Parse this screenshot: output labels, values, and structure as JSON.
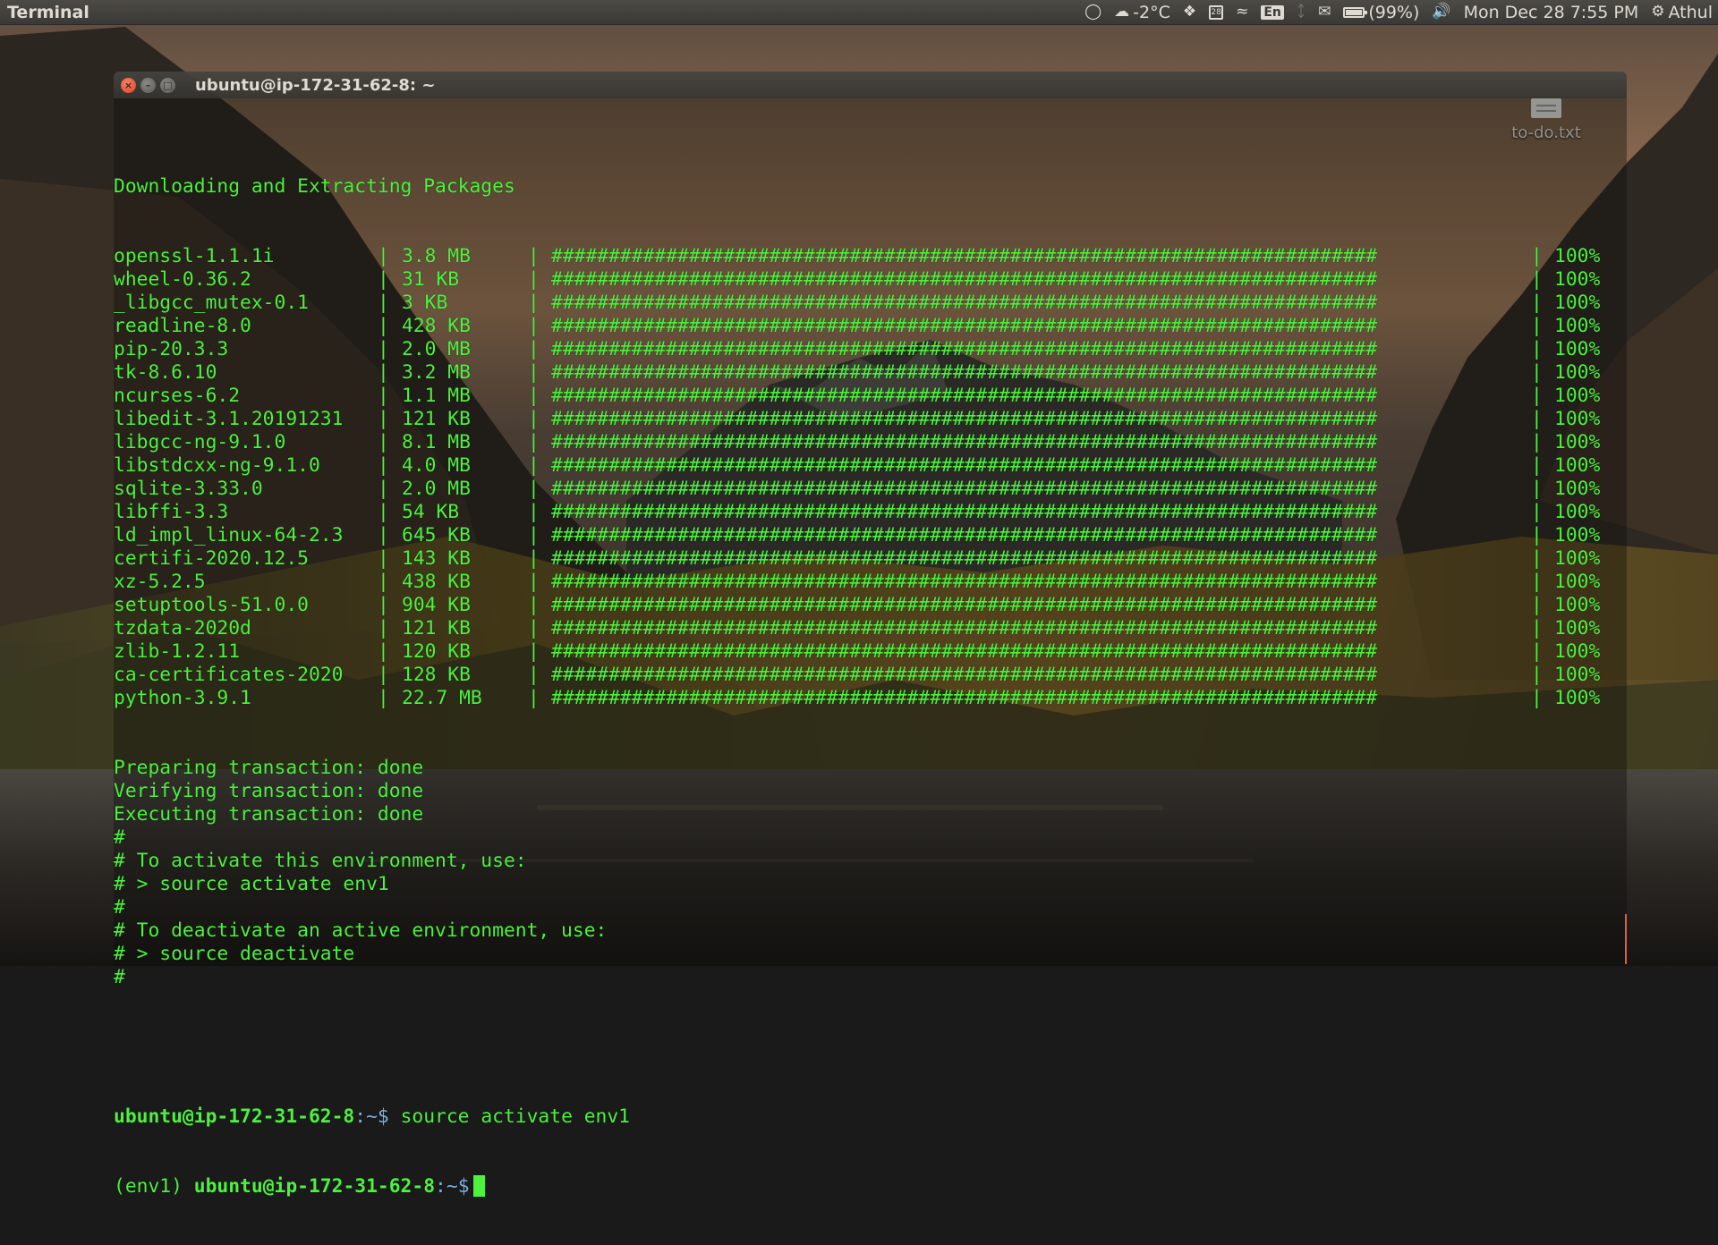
{
  "panel": {
    "app_title": "Terminal",
    "weather": "-2°C",
    "keyboard_layout": "En",
    "calendar_day": "28",
    "battery": "(99%)",
    "battery_level": 0.99,
    "datetime": "Mon Dec 28  7:55 PM",
    "user": "Athul",
    "icons": [
      "bulb-icon",
      "weather-icon",
      "dropbox-icon",
      "calendar-icon",
      "wifi-icon",
      "keyboard-icon",
      "bluetooth-icon",
      "mail-icon",
      "battery-icon",
      "volume-icon",
      "settings-gear-icon"
    ]
  },
  "window": {
    "title": "ubuntu@ip-172-31-62-8: ~"
  },
  "desktop": {
    "file_label": "to-do.txt"
  },
  "terminal": {
    "header": "Downloading and Extracting Packages",
    "progress_bar": "########################################################################",
    "packages": [
      {
        "name": "openssl-1.1.1i",
        "size": "3.8 MB",
        "percent": "100%"
      },
      {
        "name": "wheel-0.36.2",
        "size": "31 KB",
        "percent": "100%"
      },
      {
        "name": "_libgcc_mutex-0.1",
        "size": "3 KB",
        "percent": "100%"
      },
      {
        "name": "readline-8.0",
        "size": "428 KB",
        "percent": "100%"
      },
      {
        "name": "pip-20.3.3",
        "size": "2.0 MB",
        "percent": "100%"
      },
      {
        "name": "tk-8.6.10",
        "size": "3.2 MB",
        "percent": "100%"
      },
      {
        "name": "ncurses-6.2",
        "size": "1.1 MB",
        "percent": "100%"
      },
      {
        "name": "libedit-3.1.20191231",
        "size": "121 KB",
        "percent": "100%"
      },
      {
        "name": "libgcc-ng-9.1.0",
        "size": "8.1 MB",
        "percent": "100%"
      },
      {
        "name": "libstdcxx-ng-9.1.0",
        "size": "4.0 MB",
        "percent": "100%"
      },
      {
        "name": "sqlite-3.33.0",
        "size": "2.0 MB",
        "percent": "100%"
      },
      {
        "name": "libffi-3.3",
        "size": "54 KB",
        "percent": "100%"
      },
      {
        "name": "ld_impl_linux-64-2.3",
        "size": "645 KB",
        "percent": "100%"
      },
      {
        "name": "certifi-2020.12.5",
        "size": "143 KB",
        "percent": "100%"
      },
      {
        "name": "xz-5.2.5",
        "size": "438 KB",
        "percent": "100%"
      },
      {
        "name": "setuptools-51.0.0",
        "size": "904 KB",
        "percent": "100%"
      },
      {
        "name": "tzdata-2020d",
        "size": "121 KB",
        "percent": "100%"
      },
      {
        "name": "zlib-1.2.11",
        "size": "120 KB",
        "percent": "100%"
      },
      {
        "name": "ca-certificates-2020",
        "size": "128 KB",
        "percent": "100%"
      },
      {
        "name": "python-3.9.1",
        "size": "22.7 MB",
        "percent": "100%"
      }
    ],
    "status_lines": [
      "Preparing transaction: done",
      "Verifying transaction: done",
      "Executing transaction: done",
      "#",
      "# To activate this environment, use:",
      "# > source activate env1",
      "#",
      "# To deactivate an active environment, use:",
      "# > source deactivate",
      "#"
    ],
    "prompt1": {
      "host": "ubuntu@ip-172-31-62-8",
      "path": ":~",
      "symbol": "$",
      "command": " source activate env1"
    },
    "prompt2": {
      "env": "(env1) ",
      "host": "ubuntu@ip-172-31-62-8",
      "path": ":~",
      "symbol": "$"
    }
  }
}
